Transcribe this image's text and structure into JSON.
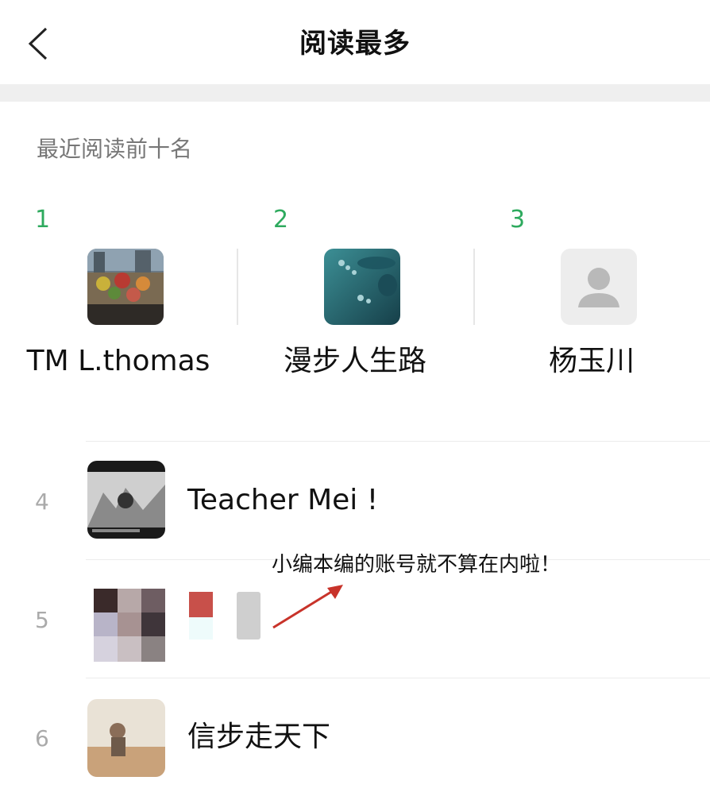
{
  "header": {
    "title": "阅读最多",
    "back_icon": "chevron-left-icon"
  },
  "section": {
    "label": "最近阅读前十名"
  },
  "top3": [
    {
      "rank": "1",
      "name": "TM L.thomas",
      "avatar": "photo-market-avatar"
    },
    {
      "rank": "2",
      "name": "漫步人生路",
      "avatar": "water-drops-avatar"
    },
    {
      "rank": "3",
      "name": "杨玉川",
      "avatar": "default-user-avatar"
    }
  ],
  "list": [
    {
      "rank": "4",
      "name": "Teacher Mei !",
      "avatar": "bw-photo-avatar"
    },
    {
      "rank": "5",
      "name": "",
      "avatar": "mosaic-avatar"
    },
    {
      "rank": "6",
      "name": "信步走天下",
      "avatar": "desert-photo-avatar"
    }
  ],
  "annotation": {
    "text": "小编本编的账号就不算在内啦！",
    "arrow_color": "#c8332a"
  },
  "colors": {
    "rank_top": "#2eaa5e",
    "rank_row": "#aaaaaa",
    "label": "#777777"
  }
}
